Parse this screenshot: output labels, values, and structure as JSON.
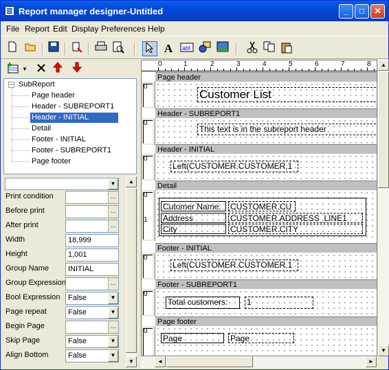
{
  "window": {
    "title": "Report manager designer-Untitled",
    "min_label": "_",
    "max_label": "□",
    "close_label": "✕"
  },
  "menu": [
    "File",
    "Report",
    "Edit",
    "Display",
    "Preferences",
    "Help"
  ],
  "tree": {
    "root": "SubReport",
    "items": [
      "Page header",
      "Header - SUBREPORT1",
      "Header - INITIAL",
      "Detail",
      "Footer - INITIAL",
      "Footer - SUBREPORT1",
      "Page footer"
    ],
    "selected_index": 2
  },
  "properties": [
    {
      "label": "Print condition",
      "value": "",
      "kind": "ellipsis"
    },
    {
      "label": "Before print",
      "value": "",
      "kind": "ellipsis"
    },
    {
      "label": "After print",
      "value": "",
      "kind": "ellipsis"
    },
    {
      "label": "Width",
      "value": "18,999",
      "kind": "text"
    },
    {
      "label": "Height",
      "value": "1,001",
      "kind": "text"
    },
    {
      "label": "Group Name",
      "value": "INITIAL",
      "kind": "text"
    },
    {
      "label": "Group Expression",
      "value": "",
      "kind": "ellipsis"
    },
    {
      "label": "Bool Expression",
      "value": "False",
      "kind": "dropdown"
    },
    {
      "label": "Page repeat",
      "value": "False",
      "kind": "dropdown"
    },
    {
      "label": "Begin Page",
      "value": "",
      "kind": "ellipsis"
    },
    {
      "label": "Skip Page",
      "value": "False",
      "kind": "dropdown"
    },
    {
      "label": "Align Bottom",
      "value": "False",
      "kind": "dropdown"
    }
  ],
  "ruler": [
    "0",
    "1",
    "2",
    "3",
    "4",
    "5",
    "6",
    "7",
    "8"
  ],
  "bands": {
    "page_header": {
      "title": "Page header",
      "ruler": "0",
      "text": "Customer List"
    },
    "header_sub": {
      "title": "Header - SUBREPORT1",
      "ruler": "0",
      "text": "This text is in the subreport header"
    },
    "header_initial": {
      "title": "Header - INITIAL",
      "ruler": "0",
      "text": "Left(CUSTOMER.CUSTOMER,1"
    },
    "detail": {
      "title": "Detail",
      "ruler0": "0",
      "ruler1": "1",
      "labels": [
        "Cutomer Name:",
        "Address",
        "City"
      ],
      "fields": [
        "CUSTOMER.CU",
        "CUSTOMER.ADDRESS_LINE1",
        "CUSTOMER.CITY"
      ]
    },
    "footer_initial": {
      "title": "Footer - INITIAL",
      "ruler": "0",
      "text": "Left(CUSTOMER.CUSTOMER,1"
    },
    "footer_sub": {
      "title": "Footer - SUBREPORT1",
      "ruler": "0",
      "label": "Total customers:",
      "field": "1"
    },
    "page_footer": {
      "title": "Page footer",
      "ruler": "0",
      "label": "Page",
      "field": "Page"
    }
  }
}
